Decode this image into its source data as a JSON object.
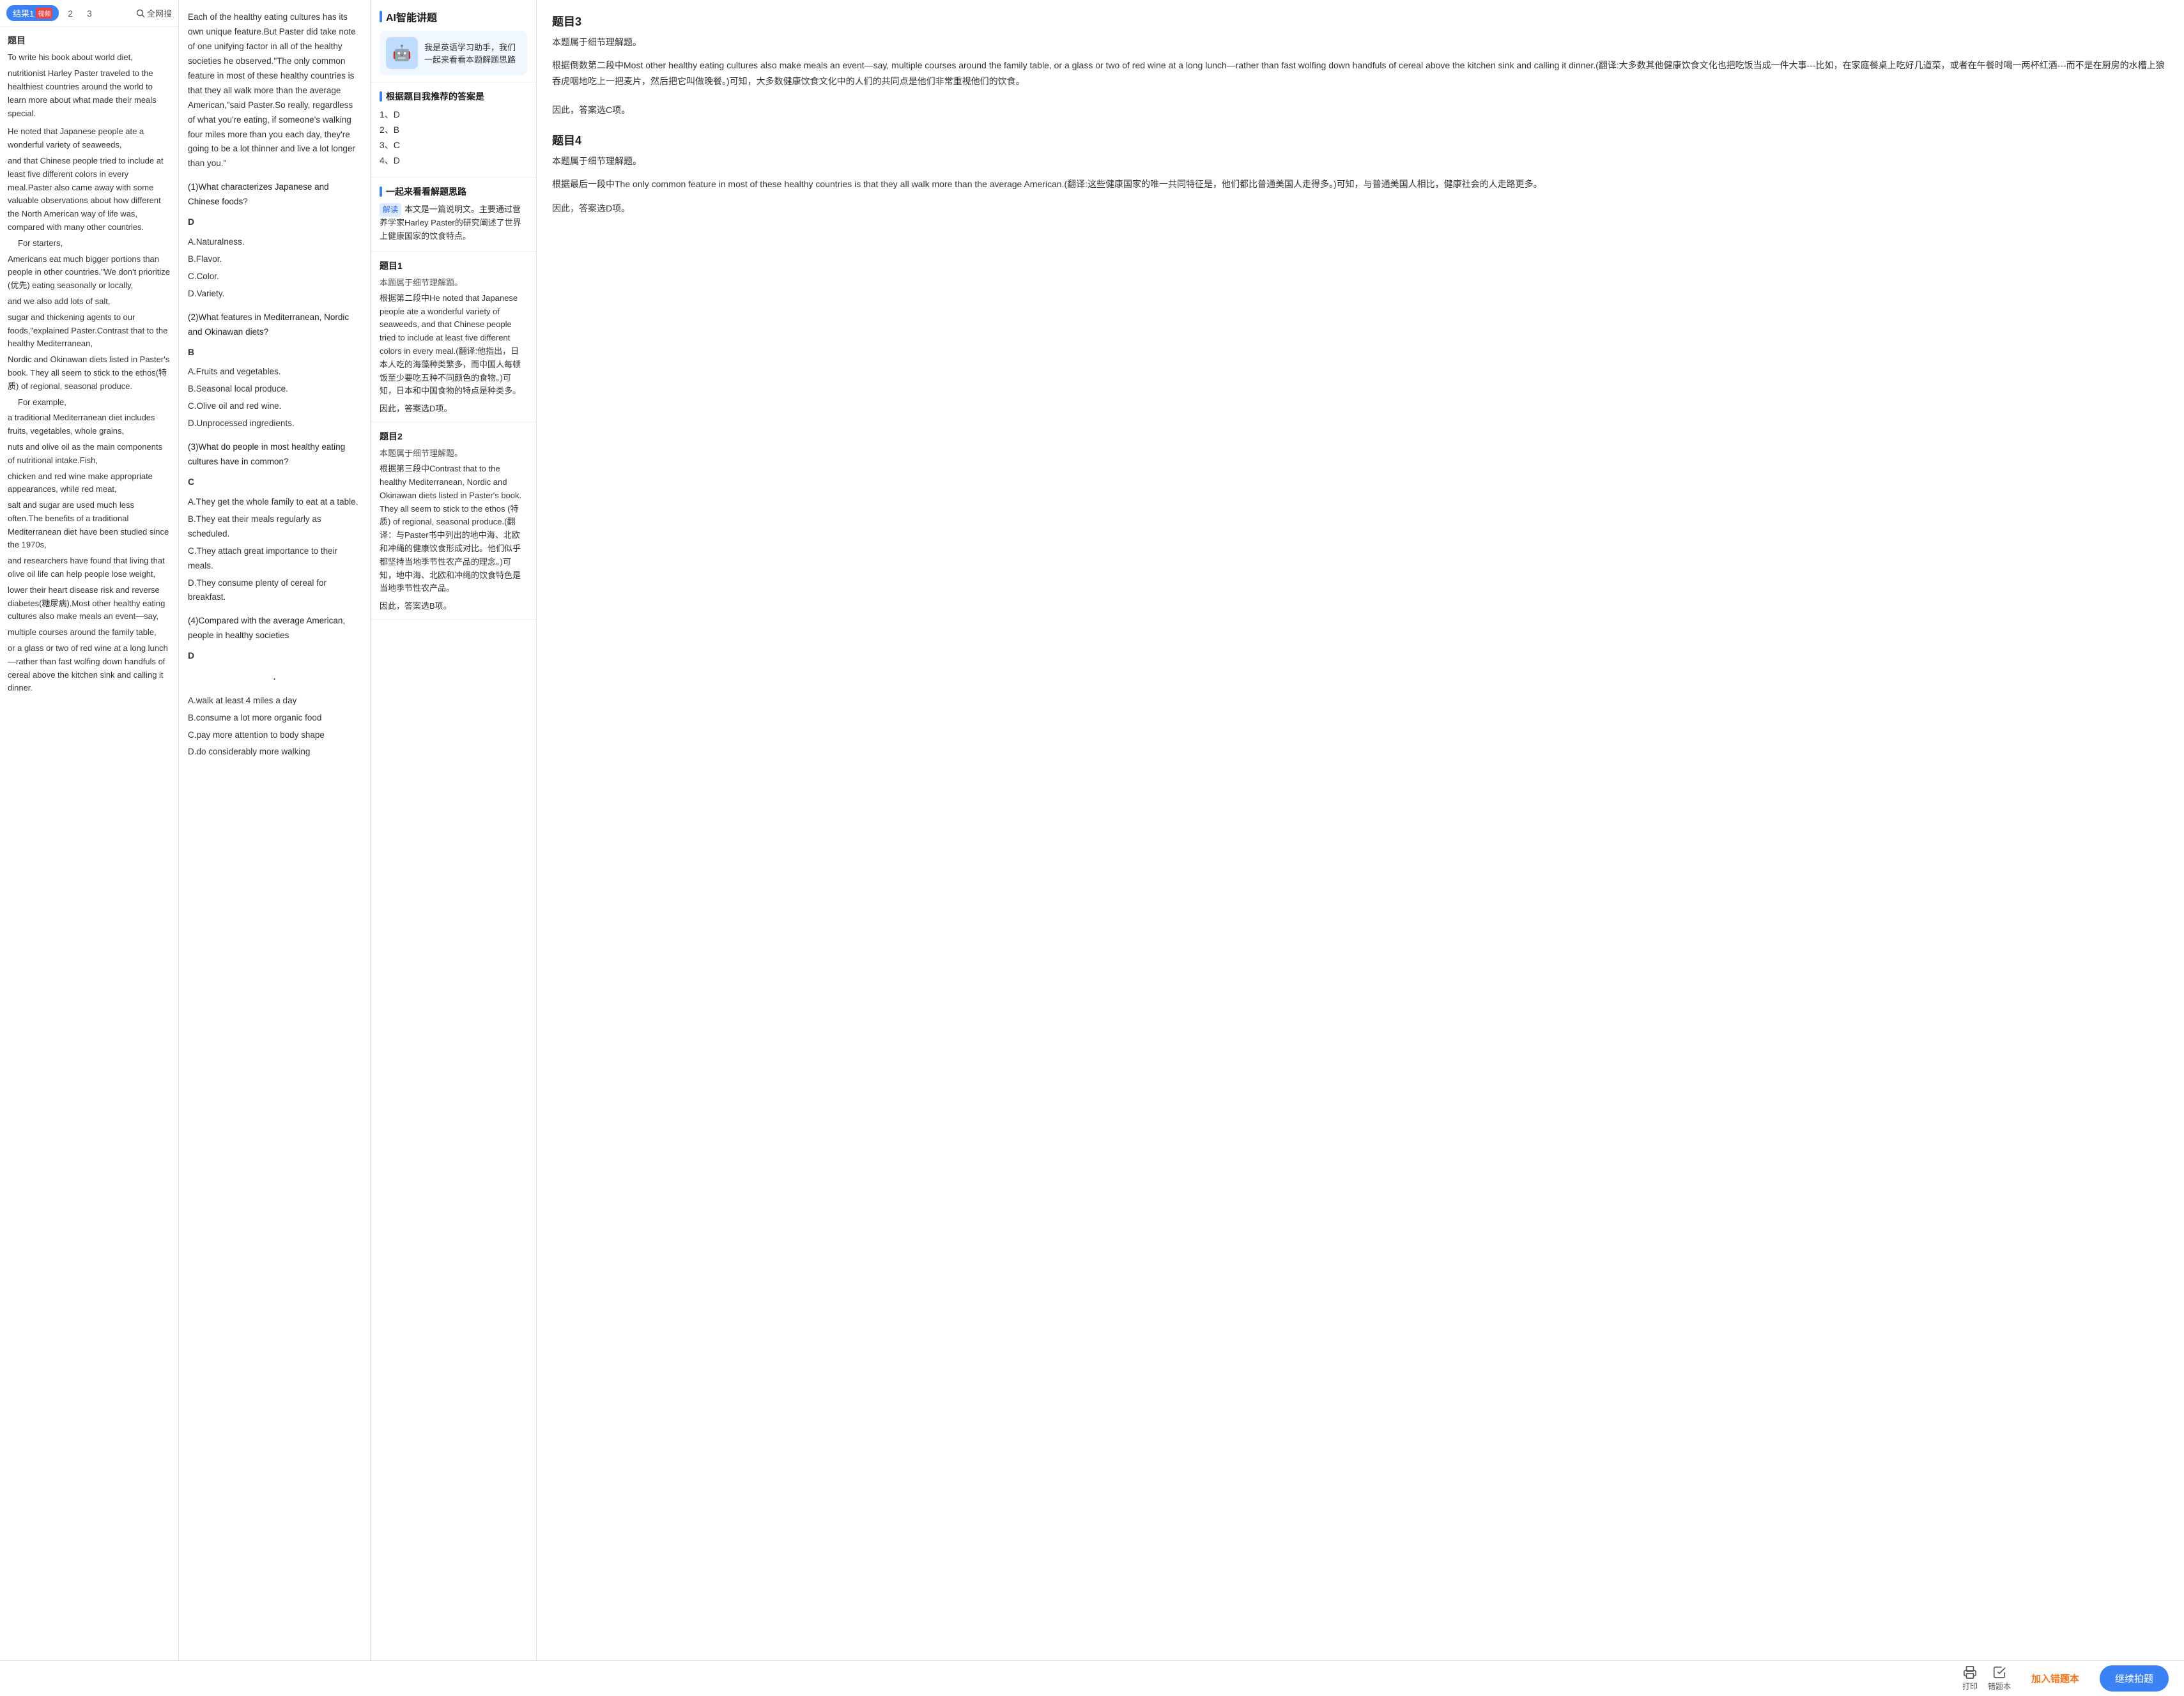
{
  "left": {
    "result_btn": "结果1",
    "video_badge": "视频",
    "tab2": "2",
    "tab3": "3",
    "search_all": "全网搜",
    "section_title": "题目",
    "paragraphs": [
      "To write his book about world diet,",
      "nutritionist Harley Paster traveled to the healthiest countries around the world to learn more about what made their meals special.",
      "He noted that Japanese people ate a wonderful variety of seaweeds,",
      "and that Chinese people tried to include at least five different colors in every meal.Paster also came away with some valuable observations about how different the North American way of life was, compared with many other countries.",
      "For starters,",
      "Americans eat much bigger portions than people in other countries.\"We don't prioritize (优先) eating seasonally or locally,",
      "and we also add lots of salt,",
      "sugar and thickening agents to our foods,\"explained Paster.Contrast that to the healthy Mediterranean,",
      "Nordic and Okinawan diets listed in Paster's book. They all seem to stick to the ethos(特质) of regional, seasonal produce.",
      "For example,",
      "a traditional Mediterranean diet includes fruits, vegetables, whole grains,",
      "nuts and olive oil as the main components of nutritional intake.Fish,",
      "chicken and red wine make appropriate appearances, while red meat,",
      "salt and sugar are used much less often.The benefits of a traditional Mediterranean diet have been studied since the 1970s,",
      "and researchers have found that living that olive oil life can help people lose weight,",
      "lower their heart disease risk and reverse diabetes(糖尿病).Most other healthy eating cultures also make meals an event—say,",
      "multiple courses around the family table,",
      "or a glass or two of red wine at a long lunch—rather than fast wolfing down handfuls of cereal above the kitchen sink and calling it dinner."
    ]
  },
  "middle": {
    "intro": "Each of the healthy eating cultures has its own unique feature.But Paster did take note of one unifying factor in all of the healthy societies he observed.\"The only common feature in most of these healthy countries is that they all walk more than the average American,\"said Paster.So really, regardless of what you're eating, if someone's walking four miles more than you each day, they're going to be a lot thinner and live a lot longer than you.\"",
    "q1_text": "(1)What characterizes Japanese and Chinese foods?",
    "q1_answer": "D",
    "q1_options": [
      "A.Naturalness.",
      "B.Flavor.",
      "C.Color.",
      "D.Variety."
    ],
    "q2_text": "(2)What features in Mediterranean, Nordic and Okinawan diets?",
    "q2_answer": "B",
    "q2_options": [
      "A.Fruits and vegetables.",
      "B.Seasonal local produce.",
      "C.Olive oil and red wine.",
      "D.Unprocessed ingredients."
    ],
    "q3_text": "(3)What do people in most healthy eating cultures have in common?",
    "q3_answer": "C",
    "q3_options": [
      "A.They get the whole family to eat at a table.",
      "B.They eat their meals regularly as scheduled.",
      "C.They attach great importance to their meals.",
      "D.They consume plenty of cereal for breakfast."
    ],
    "q4_text": "(4)Compared with the average American, people in healthy societies",
    "q4_answer": "D",
    "q4_dot": "·",
    "q4_options": [
      "A.walk at least 4 miles a day",
      "B.consume a lot more organic food",
      "C.pay more attention to body shape",
      "D.do considerably more walking"
    ]
  },
  "ai_panel": {
    "header_title": "AI智能讲题",
    "bot_text": "我是英语学习助手，我们一起来看看本题解题思路",
    "recommend_title": "根据题目我推荐的答案是",
    "recommend_answers": [
      "1、D",
      "2、B",
      "3、C",
      "4、D"
    ],
    "solution_title": "一起来看看解题思路",
    "jiedu_badge": "解读",
    "solution_text": "本文是一篇说明文。主要通过营养学家Harley Paster的研究阐述了世界上健康国家的饮食特点。",
    "q1_block": {
      "title": "题目1",
      "subtitle": "本题属于细节理解题。",
      "analysis": "根据第二段中He noted that Japanese people ate a wonderful variety of seaweeds, and that Chinese people tried to include at least five different colors in every meal.(翻译:他指出，日本人吃的海藻种类繁多，而中国人每顿饭至少要吃五种不同颜色的食物。)可知，日本和中国食物的特点是种类多。",
      "conclusion": "因此，答案选D项。"
    },
    "q2_block": {
      "title": "题目2",
      "subtitle": "本题属于细节理解题。",
      "analysis": "根据第三段中Contrast that to the healthy Mediterranean, Nordic and Okinawan diets listed in Paster's book. They all seem to stick to the ethos (特质) of regional, seasonal produce.(翻译：与Paster书中列出的地中海、北欧和冲绳的健康饮食形成对比。他们似乎都坚持当地季节性农产品的理念。)可知，地中海、北欧和冲绳的饮食特色是当地季节性农产品。",
      "conclusion": "因此，答案选B项。"
    }
  },
  "far_right": {
    "q3_num": "题目3",
    "q3_type": "本题属于细节理解题。",
    "q3_analysis": "根据倒数第二段中Most other healthy eating cultures also make meals an event—say, multiple courses around the family table, or a glass or two of red wine at a long lunch—rather than fast wolfing down handfuls of cereal above the kitchen sink and calling it dinner.(翻译:大多数其他健康饮食文化也把吃饭当成一件大事---比如，在家庭餐桌上吃好几道菜，或者在午餐时喝一两杯红酒---而不是在厨房的水槽上狼吞虎咽地吃上一把麦片，然后把它叫做晚餐。)可知，大多数健康饮食文化中的人们的共同点是他们非常重视他们的饮食。",
    "q3_conclusion": "因此，答案选C项。",
    "q4_num": "题目4",
    "q4_type": "本题属于细节理解题。",
    "q4_analysis": "根据最后一段中The only common feature in most of these healthy countries is that they all walk more than the average American.(翻译:这些健康国家的唯一共同特征是，他们都比普通美国人走得多。)可知，与普通美国人相比，健康社会的人走路更多。",
    "q4_conclusion": "因此，答案选D项。"
  },
  "bottom_bar": {
    "print_label": "打印",
    "error_label": "错题本",
    "join_label": "加入错题本",
    "continue_label": "继续拍题"
  }
}
